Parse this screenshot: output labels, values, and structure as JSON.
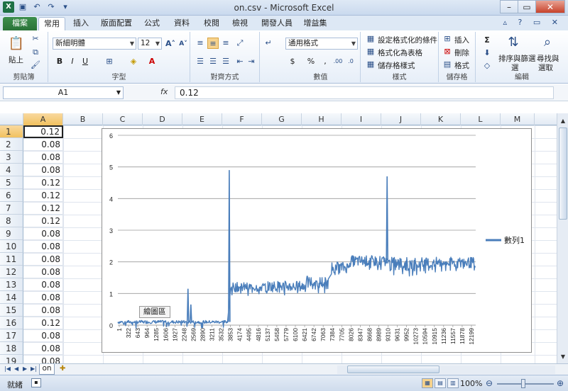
{
  "window": {
    "title": "on.csv - Microsoft Excel"
  },
  "tabs": [
    "檔案",
    "常用",
    "插入",
    "版面配置",
    "公式",
    "資料",
    "校閱",
    "檢視",
    "開發人員",
    "增益集"
  ],
  "ribbon": {
    "clipboard": {
      "paste": "貼上",
      "label": "剪貼簿"
    },
    "font": {
      "name": "新細明體",
      "size": "12",
      "label": "字型"
    },
    "alignment": {
      "label": "對齊方式"
    },
    "number": {
      "format": "通用格式",
      "label": "數值"
    },
    "styles": {
      "cond": "設定格式化的條件",
      "table": "格式化為表格",
      "cellstyle": "儲存格樣式",
      "label": "樣式"
    },
    "cells": {
      "insert": "插入",
      "delete": "刪除",
      "format": "格式",
      "label": "儲存格"
    },
    "editing": {
      "sort1": "排序與篩選",
      "sort2": "選",
      "find1": "尋找與",
      "find2": "選取",
      "label": "編輯"
    }
  },
  "formula_bar": {
    "name_box": "A1",
    "fx": "fx",
    "value": "0.12"
  },
  "columns": [
    "A",
    "B",
    "C",
    "D",
    "E",
    "F",
    "G",
    "H",
    "I",
    "J",
    "K",
    "L",
    "M"
  ],
  "rows": [
    {
      "n": "1",
      "a": "0.12"
    },
    {
      "n": "2",
      "a": "0.08"
    },
    {
      "n": "3",
      "a": "0.08"
    },
    {
      "n": "4",
      "a": "0.08"
    },
    {
      "n": "5",
      "a": "0.12"
    },
    {
      "n": "6",
      "a": "0.12"
    },
    {
      "n": "7",
      "a": "0.12"
    },
    {
      "n": "8",
      "a": "0.12"
    },
    {
      "n": "9",
      "a": "0.08"
    },
    {
      "n": "10",
      "a": "0.08"
    },
    {
      "n": "11",
      "a": "0.08"
    },
    {
      "n": "12",
      "a": "0.08"
    },
    {
      "n": "13",
      "a": "0.08"
    },
    {
      "n": "14",
      "a": "0.08"
    },
    {
      "n": "15",
      "a": "0.08"
    },
    {
      "n": "16",
      "a": "0.12"
    },
    {
      "n": "17",
      "a": "0.08"
    },
    {
      "n": "18",
      "a": "0.08"
    },
    {
      "n": "19",
      "a": "0.08"
    }
  ],
  "sheet": {
    "name": "on"
  },
  "tooltip": "繪圖區",
  "status": {
    "ready": "就緒",
    "zoom": "100%"
  },
  "colors": {
    "series": "#4a7ebb",
    "file_tab": "#2a7339",
    "selection": "#f1c15f"
  },
  "chart_data": {
    "type": "line",
    "title": "",
    "xlabel": "",
    "ylabel": "",
    "ylim": [
      0,
      6
    ],
    "yticks": [
      "0",
      "1",
      "2",
      "3",
      "4",
      "5",
      "6"
    ],
    "xticks": [
      "1",
      "322",
      "643",
      "964",
      "1285",
      "1606",
      "1927",
      "2248",
      "2569",
      "2890",
      "3211",
      "3532",
      "3853",
      "4174",
      "4495",
      "4816",
      "5137",
      "5458",
      "5779",
      "6100",
      "6421",
      "6742",
      "7063",
      "7384",
      "7705",
      "8026",
      "8347",
      "8668",
      "8989",
      "9310",
      "9631",
      "9952",
      "10273",
      "10594",
      "10915",
      "11236",
      "11557",
      "11878",
      "12199"
    ],
    "xmax": 12400,
    "legend_position": "right",
    "series": [
      {
        "name": "數列1",
        "segments": [
          {
            "x0": 1,
            "x1": 3800,
            "lo": 0.05,
            "hi": 0.15
          },
          {
            "x0": 3900,
            "x1": 5200,
            "lo": 1.05,
            "hi": 1.35
          },
          {
            "x0": 5200,
            "x1": 6500,
            "lo": 1.05,
            "hi": 1.4
          },
          {
            "x0": 6500,
            "x1": 7300,
            "lo": 1.15,
            "hi": 1.55
          },
          {
            "x0": 7400,
            "x1": 8000,
            "lo": 1.65,
            "hi": 2.0
          },
          {
            "x0": 8000,
            "x1": 9300,
            "lo": 1.85,
            "hi": 2.2
          },
          {
            "x0": 9400,
            "x1": 11000,
            "lo": 1.7,
            "hi": 2.15
          },
          {
            "x0": 11000,
            "x1": 12400,
            "lo": 1.8,
            "hi": 2.15
          }
        ],
        "spikes": [
          {
            "x": 2430,
            "y": 1.15
          },
          {
            "x": 2530,
            "y": 0.65
          },
          {
            "x": 3860,
            "y": 4.9
          },
          {
            "x": 9330,
            "y": 4.7
          }
        ]
      }
    ]
  }
}
